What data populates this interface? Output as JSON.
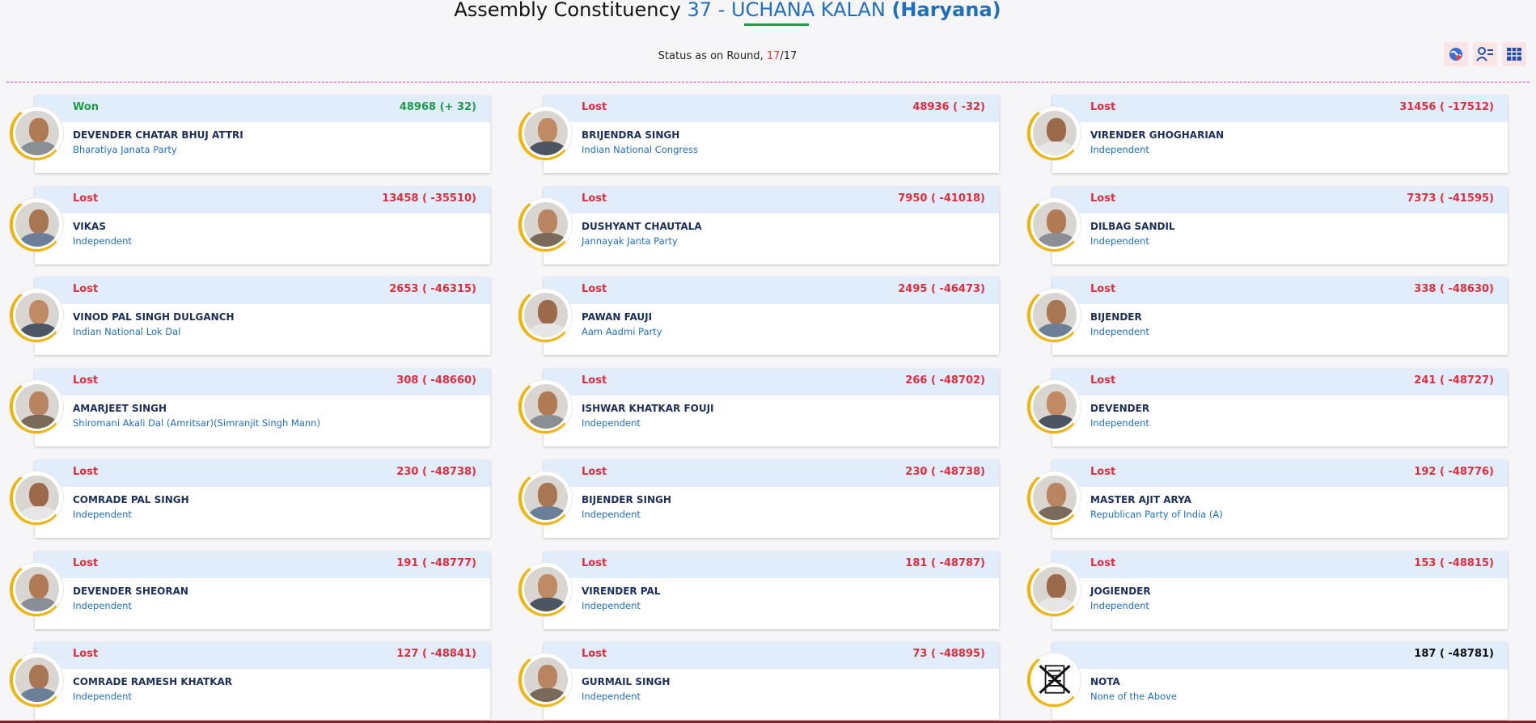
{
  "header": {
    "prefix": "Assembly Constituency",
    "ac_number": "37 - UCHANA KALAN",
    "state": "(Haryana)"
  },
  "status": {
    "label": "Status as on Round,",
    "current_round": "17",
    "separator": "/",
    "total_rounds": "17"
  },
  "toolbar_icons": [
    "globe-icon",
    "user-list-icon",
    "table-grid-icon"
  ],
  "candidates": [
    {
      "status": "Won",
      "votes": "48968 (+ 32)",
      "name": "DEVENDER CHATAR BHUJ ATTRI",
      "party": "Bharatiya Janata Party",
      "won": true
    },
    {
      "status": "Lost",
      "votes": "48936 ( -32)",
      "name": "BRIJENDRA SINGH",
      "party": "Indian National Congress"
    },
    {
      "status": "Lost",
      "votes": "31456 ( -17512)",
      "name": "VIRENDER GHOGHARIAN",
      "party": "Independent"
    },
    {
      "status": "Lost",
      "votes": "13458 ( -35510)",
      "name": "VIKAS",
      "party": "Independent"
    },
    {
      "status": "Lost",
      "votes": "7950 ( -41018)",
      "name": "DUSHYANT CHAUTALA",
      "party": "Jannayak Janta Party"
    },
    {
      "status": "Lost",
      "votes": "7373 ( -41595)",
      "name": "DILBAG SANDIL",
      "party": "Independent"
    },
    {
      "status": "Lost",
      "votes": "2653 ( -46315)",
      "name": "VINOD PAL SINGH DULGANCH",
      "party": "Indian National Lok Dal"
    },
    {
      "status": "Lost",
      "votes": "2495 ( -46473)",
      "name": "PAWAN FAUJI",
      "party": "Aam Aadmi Party"
    },
    {
      "status": "Lost",
      "votes": "338 ( -48630)",
      "name": "BIJENDER",
      "party": "Independent"
    },
    {
      "status": "Lost",
      "votes": "308 ( -48660)",
      "name": "AMARJEET SINGH",
      "party": "Shiromani Akali Dal (Amritsar)(Simranjit Singh Mann)"
    },
    {
      "status": "Lost",
      "votes": "266 ( -48702)",
      "name": "ISHWAR KHATKAR FOUJI",
      "party": "Independent"
    },
    {
      "status": "Lost",
      "votes": "241 ( -48727)",
      "name": "DEVENDER",
      "party": "Independent"
    },
    {
      "status": "Lost",
      "votes": "230 ( -48738)",
      "name": "COMRADE PAL SINGH",
      "party": "Independent"
    },
    {
      "status": "Lost",
      "votes": "230 ( -48738)",
      "name": "BIJENDER SINGH",
      "party": "Independent"
    },
    {
      "status": "Lost",
      "votes": "192 ( -48776)",
      "name": "MASTER AJIT ARYA",
      "party": "Republican Party of India (A)"
    },
    {
      "status": "Lost",
      "votes": "191 ( -48777)",
      "name": "DEVENDER SHEORAN",
      "party": "Independent"
    },
    {
      "status": "Lost",
      "votes": "181 ( -48787)",
      "name": "VIRENDER PAL",
      "party": "Independent"
    },
    {
      "status": "Lost",
      "votes": "153 ( -48815)",
      "name": "JOGIENDER",
      "party": "Independent"
    },
    {
      "status": "Lost",
      "votes": "127 ( -48841)",
      "name": "COMRADE RAMESH KHATKAR",
      "party": "Independent"
    },
    {
      "status": "Lost",
      "votes": "73 ( -48895)",
      "name": "GURMAIL SINGH",
      "party": "Independent"
    },
    {
      "status": "",
      "votes": "187 ( -48781)",
      "name": "NOTA",
      "party": "None of the Above",
      "nota": true
    }
  ],
  "colors": {
    "won": "#1f9a4a",
    "lost": "#e02d3c",
    "link": "#1f6fbf",
    "band": "#e2edfb",
    "avatar_ring": "#f1b400",
    "divider": "#d93bd4"
  }
}
